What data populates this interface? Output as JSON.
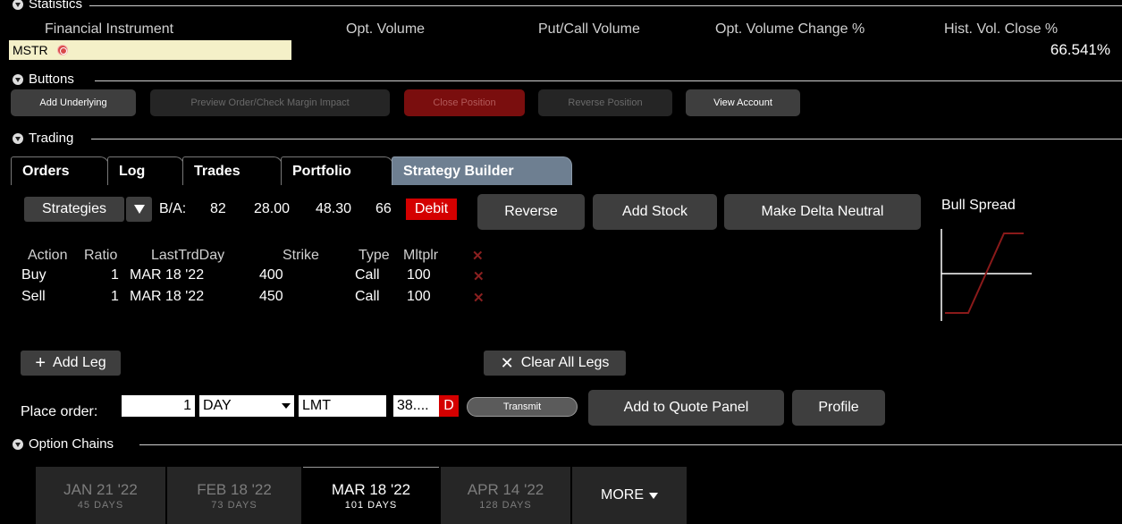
{
  "statistics": {
    "title": "Statistics",
    "headers": [
      "Financial Instrument",
      "Opt. Volume",
      "Put/Call Volume",
      "Opt. Volume Change %",
      "Hist. Vol. Close %"
    ],
    "symbol": "MSTR",
    "hist_vol": "66.541%"
  },
  "buttons_section": {
    "title": "Buttons",
    "items": [
      "Add Underlying",
      "Preview Order/Check Margin Impact",
      "Close Position",
      "Reverse Position",
      "View Account"
    ]
  },
  "trading": {
    "title": "Trading",
    "tabs": [
      "Orders",
      "Log",
      "Trades",
      "Portfolio",
      "Strategy Builder"
    ],
    "active_tab": "Strategy Builder"
  },
  "strategy": {
    "strategies_label": "Strategies",
    "ba_label": "B/A:",
    "ba_size": "82",
    "bid": "28.00",
    "ask": "48.30",
    "ask_size": "66",
    "debit_label": "Debit",
    "reverse_label": "Reverse",
    "add_stock_label": "Add Stock",
    "delta_neutral_label": "Make Delta Neutral",
    "chart_title": "Bull Spread",
    "columns": [
      "Action",
      "Ratio",
      "LastTrdDay",
      "Strike",
      "Type",
      "Mltplr"
    ],
    "legs": [
      {
        "action": "Buy",
        "ratio": "1",
        "last_trd_day": "MAR 18 '22",
        "strike": "400",
        "type": "Call",
        "mltplr": "100"
      },
      {
        "action": "Sell",
        "ratio": "1",
        "last_trd_day": "MAR 18 '22",
        "strike": "450",
        "type": "Call",
        "mltplr": "100"
      }
    ],
    "add_leg_label": "Add Leg",
    "clear_legs_label": "Clear All Legs"
  },
  "order": {
    "place_order_label": "Place order:",
    "quantity": "1",
    "tif": "DAY",
    "order_type": "LMT",
    "price": "38....",
    "price_badge": "D",
    "transmit_label": "Transmit",
    "add_quote_label": "Add to Quote Panel",
    "profile_label": "Profile"
  },
  "option_chains": {
    "title": "Option Chains",
    "expiries": [
      {
        "date": "JAN 21 '22",
        "days": "45 DAYS"
      },
      {
        "date": "FEB 18 '22",
        "days": "73 DAYS"
      },
      {
        "date": "MAR 18 '22",
        "days": "101 DAYS"
      },
      {
        "date": "APR 14 '22",
        "days": "128 DAYS"
      }
    ],
    "active_expiry": "MAR 18 '22",
    "more_label": "MORE"
  },
  "colors": {
    "active_tab": "#6e7f91",
    "debit": "#d40000",
    "instrument_bg": "#f4f0c8",
    "payoff_line": "#8a1a1a"
  }
}
